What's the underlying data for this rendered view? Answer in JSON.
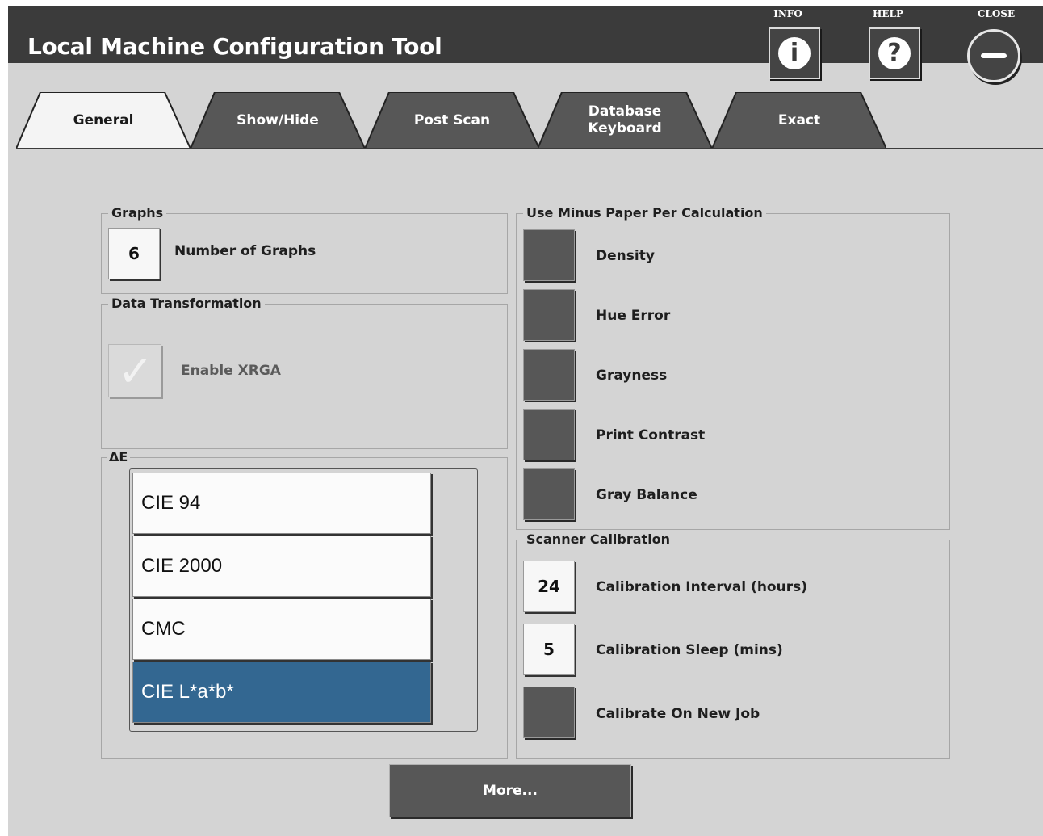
{
  "title": "Local Machine Configuration Tool",
  "header": {
    "info_label": "INFO",
    "help_label": "HELP",
    "close_label": "CLOSE",
    "info_glyph": "i",
    "help_glyph": "?"
  },
  "tabs": [
    {
      "label": "General",
      "active": true
    },
    {
      "label": "Show/Hide",
      "active": false
    },
    {
      "label": "Post Scan",
      "active": false
    },
    {
      "label": "Database Keyboard",
      "active": false
    },
    {
      "label": "Exact",
      "active": false
    }
  ],
  "graphs": {
    "title": "Graphs",
    "count": "6",
    "count_label": "Number of Graphs"
  },
  "data_transformation": {
    "title": "Data Transformation",
    "enable_xrga_label": "Enable XRGA",
    "enable_xrga_checked": true,
    "enabled": false
  },
  "delta_e": {
    "title": "ΔE",
    "options": [
      "CIE 94",
      "CIE 2000",
      "CMC",
      "CIE L*a*b*"
    ],
    "selected": "CIE L*a*b*"
  },
  "minus_paper": {
    "title": "Use Minus Paper Per Calculation",
    "items": [
      "Density",
      "Hue Error",
      "Grayness",
      "Print Contrast",
      "Gray Balance"
    ]
  },
  "scanner_calibration": {
    "title": "Scanner Calibration",
    "interval_value": "24",
    "interval_label": "Calibration Interval (hours)",
    "sleep_value": "5",
    "sleep_label": "Calibration Sleep (mins)",
    "new_job_label": "Calibrate On New Job"
  },
  "more_label": "More...",
  "colors": {
    "header_bg": "#3b3b3b",
    "panel_bg": "#d4d4d4",
    "tab_inactive": "#575757",
    "selected_blue": "#336791",
    "toggle_off": "#575757"
  }
}
